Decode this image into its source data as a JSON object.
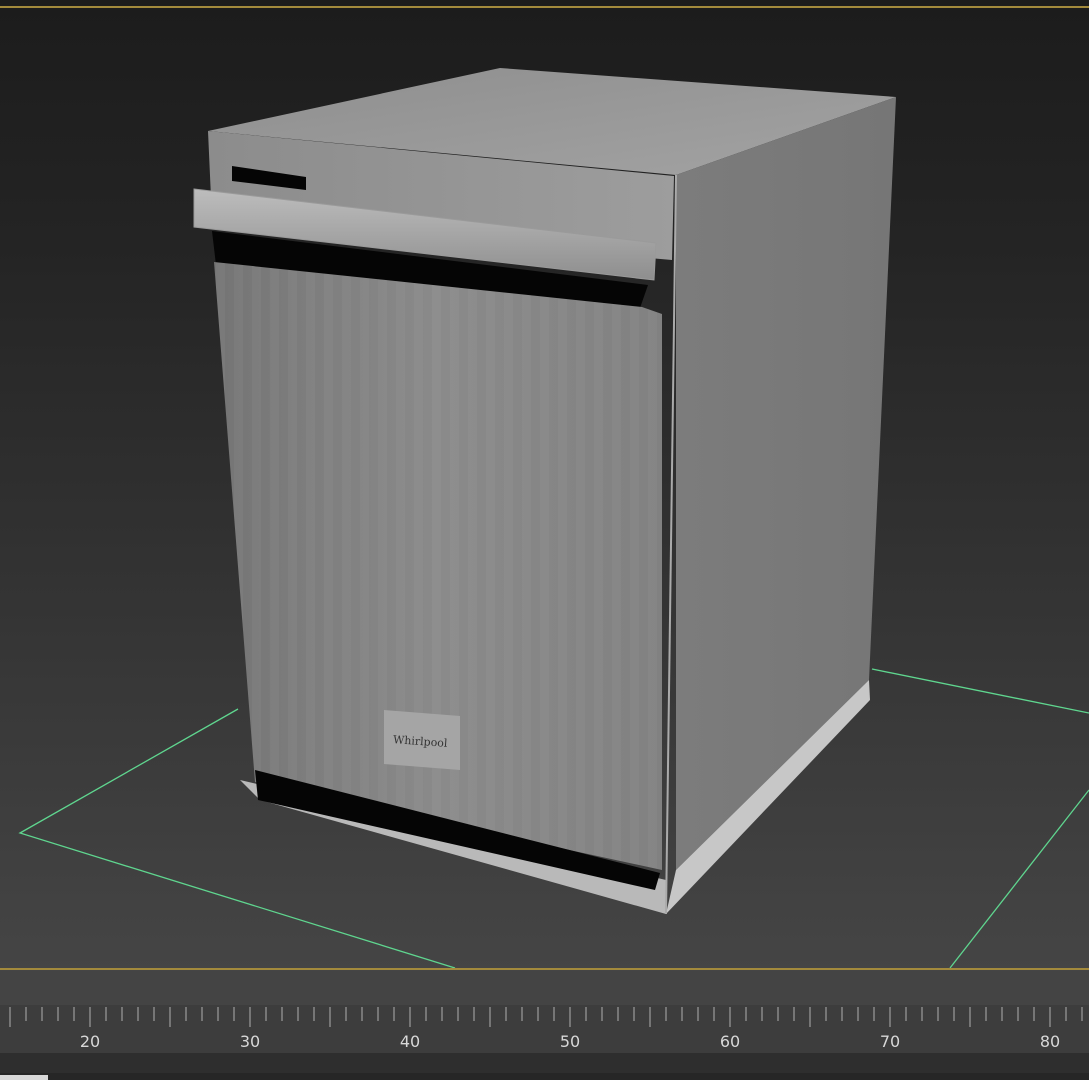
{
  "viewport": {
    "object": "dishwasher",
    "logo_text": "Whirlpool",
    "colors": {
      "frame_border": "#a38a3c",
      "grid_outline": "#5fd68f",
      "background_top": "#1c1c1c",
      "background_bottom": "#454545"
    }
  },
  "timeline": {
    "ruler_labels": [
      "20",
      "30",
      "40",
      "50",
      "60",
      "70",
      "80"
    ]
  }
}
